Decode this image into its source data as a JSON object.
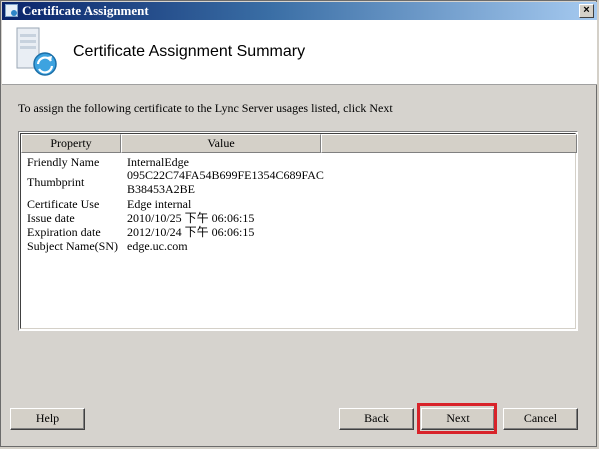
{
  "window": {
    "title": "Certificate Assignment",
    "close_glyph": "×"
  },
  "header": {
    "title": "Certificate Assignment Summary",
    "icon": "certificate-server-icon"
  },
  "instruction": "To assign the following certificate to the Lync Server usages listed, click Next",
  "table": {
    "columns": [
      "Property",
      "Value"
    ],
    "rows": [
      {
        "property": "Friendly Name",
        "value": "InternalEdge"
      },
      {
        "property": "Thumbprint",
        "value": "095C22C74FA54B699FE1354C689FAC",
        "value2": "B38453A2BE"
      },
      {
        "property": "Certificate Use",
        "value": "Edge internal"
      },
      {
        "property": "Issue date",
        "value": "2010/10/25 下午 06:06:15"
      },
      {
        "property": "Expiration date",
        "value": "2012/10/24 下午 06:06:15"
      },
      {
        "property": "Subject Name(SN)",
        "value": "edge.uc.com"
      }
    ]
  },
  "buttons": {
    "help": "Help",
    "back": "Back",
    "next": "Next",
    "cancel": "Cancel"
  },
  "colors": {
    "highlight": "#d8232a",
    "titlebar": "#0a246a"
  }
}
